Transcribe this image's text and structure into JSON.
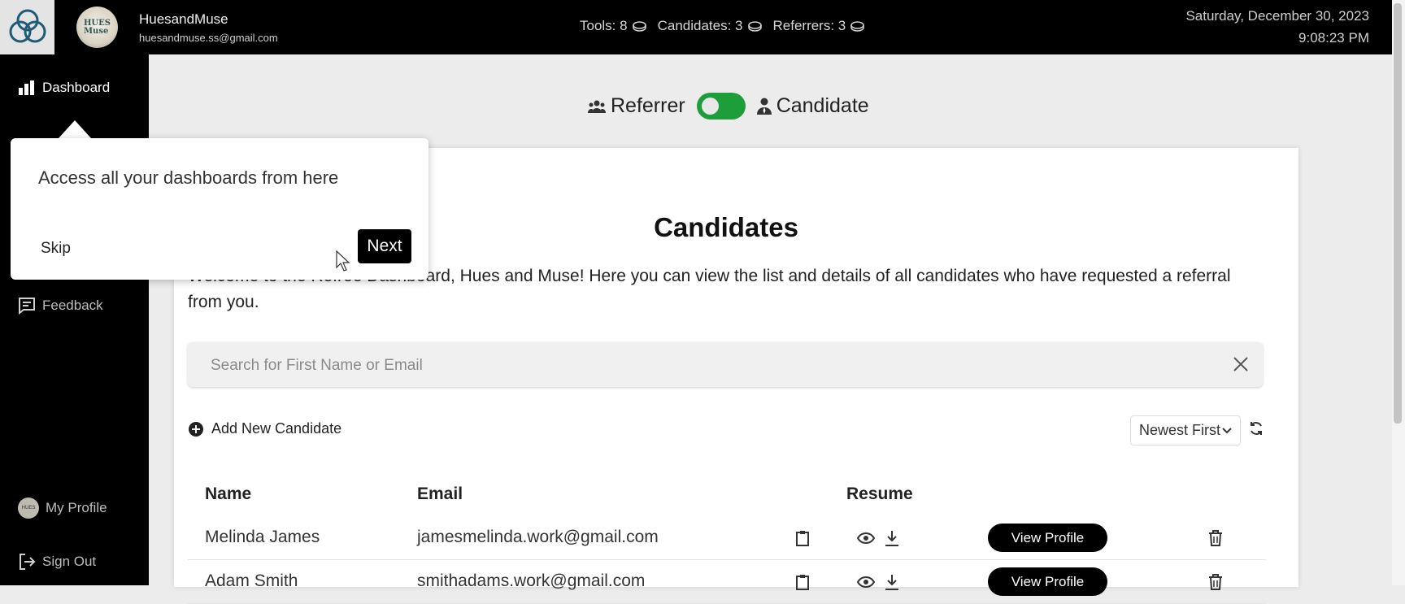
{
  "header": {
    "user_name": "HuesandMuse",
    "user_email": "huesandmuse.ss@gmail.com",
    "avatar_text": "HUES Muse",
    "counts": [
      {
        "label": "Tools: 8",
        "icon": "coin-icon"
      },
      {
        "label": "Candidates: 3",
        "icon": "coin-icon"
      },
      {
        "label": "Referrers: 3",
        "icon": "coin-icon"
      }
    ],
    "date": "Saturday, December 30, 2023",
    "time": "9:08:23 PM"
  },
  "sidebar": {
    "items": [
      {
        "label": "Dashboard",
        "icon": "bar-chart-icon"
      },
      {
        "label": "Feedback",
        "icon": "feedback-icon"
      },
      {
        "label": "My Profile",
        "icon": "avatar"
      },
      {
        "label": "Sign Out",
        "icon": "sign-out-icon"
      }
    ]
  },
  "toggle": {
    "left_label": "Referrer",
    "right_label": "Candidate",
    "state": "on",
    "accent": "#1e9e3b"
  },
  "main": {
    "title": "Candidates",
    "intro": "Welcome to the Refree Dashboard, Hues and Muse! Here you can view the list and details of all candidates who have requested a referral from you.",
    "search_placeholder": "Search for First Name or Email",
    "add_new_label": "Add New Candidate",
    "sort_selected": "Newest First"
  },
  "table": {
    "headers": {
      "name": "Name",
      "email": "Email",
      "resume": "Resume"
    },
    "rows": [
      {
        "name": "Melinda James",
        "email": "jamesmelinda.work@gmail.com",
        "action": "View Profile"
      },
      {
        "name": "Adam Smith",
        "email": "smithadams.work@gmail.com",
        "action": "View Profile"
      }
    ]
  },
  "tour": {
    "text": "Access all your dashboards from here",
    "skip_label": "Skip",
    "next_label": "Next"
  }
}
